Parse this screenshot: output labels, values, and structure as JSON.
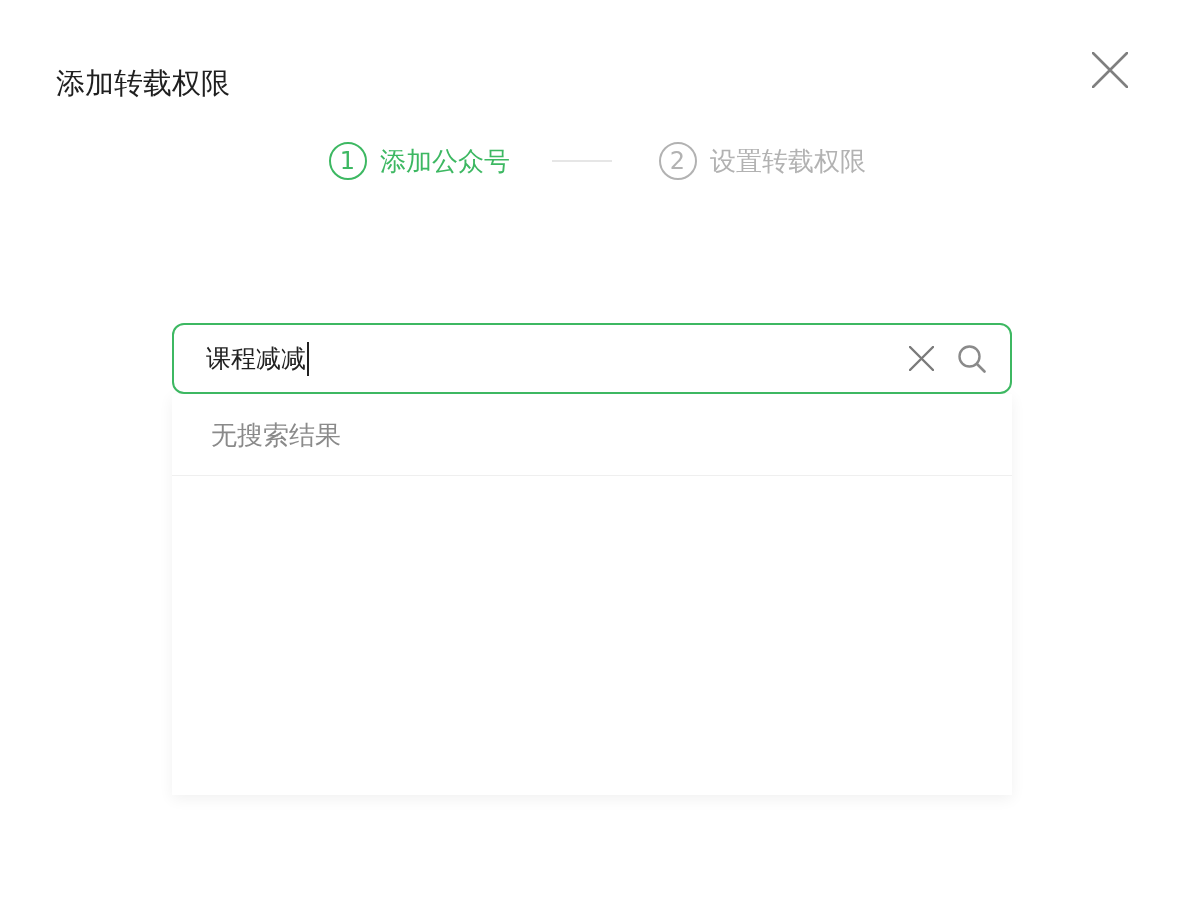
{
  "dialog": {
    "title": "添加转载权限"
  },
  "steps": [
    {
      "number": "1",
      "label": "添加公众号",
      "selected": true
    },
    {
      "number": "2",
      "label": "设置转载权限",
      "selected": false
    }
  ],
  "search": {
    "value": "课程减减",
    "focused": true
  },
  "results": {
    "message": "无搜索结果"
  }
}
